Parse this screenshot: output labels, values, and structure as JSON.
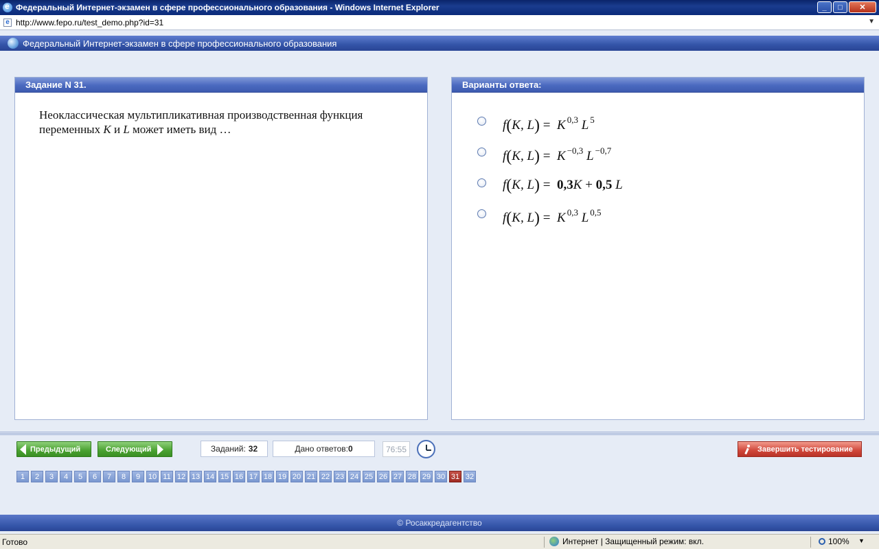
{
  "window": {
    "title": "Федеральный Интернет-экзамен в сфере профессионального образования - Windows Internet Explorer",
    "url": "http://www.fepo.ru/test_demo.php?id=31",
    "min": "_",
    "max": "□",
    "close": "✕"
  },
  "header": {
    "title": "Федеральный Интернет-экзамен в сфере профессионального образования"
  },
  "task": {
    "heading": "Задание N 31.",
    "text_part1": "Неоклассическая мультипликативная производственная функция переменных ",
    "var_k": "K",
    "text_and": " и ",
    "var_l": "L",
    "text_part2": " может иметь вид …"
  },
  "answers": {
    "heading": "Варианты ответа:",
    "options": [
      {
        "lhs_f": "f",
        "lhs_args": "K, L",
        "rhs_a": "K",
        "exp_a": "0,3",
        "rhs_b": "L",
        "exp_b": "5"
      },
      {
        "lhs_f": "f",
        "lhs_args": "K, L",
        "rhs_a": "K",
        "exp_a": "−0,3",
        "rhs_b": "L",
        "exp_b": "−0,7"
      },
      {
        "lhs_f": "f",
        "lhs_args": "K, L",
        "coef_a": "0,3",
        "rhs_a": "K",
        "plus": "+",
        "coef_b": "0,5",
        "rhs_b": "L"
      },
      {
        "lhs_f": "f",
        "lhs_args": "K, L",
        "rhs_a": "K",
        "exp_a": "0,3",
        "rhs_b": "L",
        "exp_b": "0,5"
      }
    ]
  },
  "controls": {
    "prev_label": "Предыдущий",
    "next_label": "Следующий",
    "tasks_label": "Заданий:",
    "tasks_value": "32",
    "answered_label": "Дано ответов:",
    "answered_value": "0",
    "timer": "76:55",
    "finish_label": "Завершить тестирование"
  },
  "pagination": {
    "pages": [
      "1",
      "2",
      "3",
      "4",
      "5",
      "6",
      "7",
      "8",
      "9",
      "10",
      "11",
      "12",
      "13",
      "14",
      "15",
      "16",
      "17",
      "18",
      "19",
      "20",
      "21",
      "22",
      "23",
      "24",
      "25",
      "26",
      "27",
      "28",
      "29",
      "30",
      "31",
      "32"
    ],
    "active": "31"
  },
  "footer": {
    "copyright": "© Росаккредагентство"
  },
  "statusbar": {
    "status": "Готово",
    "zone": "Интернет | Защищенный режим: вкл.",
    "zoom": "100%"
  }
}
